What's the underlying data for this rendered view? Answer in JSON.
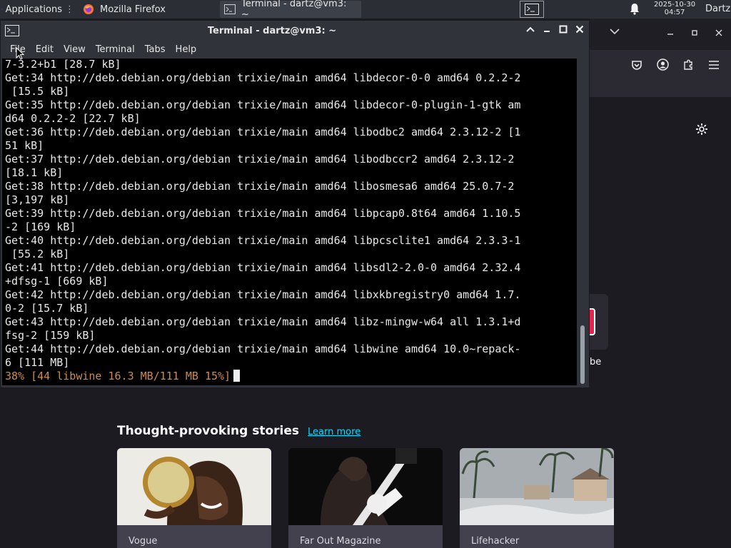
{
  "taskbar": {
    "apps_label": "Applications",
    "tasks": [
      {
        "label": "Mozilla Firefox",
        "icon": "firefox-icon"
      },
      {
        "label": "Terminal - dartz@vm3: ~",
        "icon": "terminal-icon"
      }
    ],
    "clock_date": "2025-10-30",
    "clock_time": "04:57",
    "user": "Dartz"
  },
  "terminal": {
    "title": "Terminal - dartz@vm3: ~",
    "menu": [
      "File",
      "Edit",
      "View",
      "Terminal",
      "Tabs",
      "Help"
    ],
    "lines": [
      "7-3.2+b1 [28.7 kB]",
      "Get:34 http://deb.debian.org/debian trixie/main amd64 libdecor-0-0 amd64 0.2.2-2",
      " [15.5 kB]",
      "Get:35 http://deb.debian.org/debian trixie/main amd64 libdecor-0-plugin-1-gtk am",
      "d64 0.2.2-2 [22.7 kB]",
      "Get:36 http://deb.debian.org/debian trixie/main amd64 libodbc2 amd64 2.3.12-2 [1",
      "51 kB]",
      "Get:37 http://deb.debian.org/debian trixie/main amd64 libodbccr2 amd64 2.3.12-2",
      "[18.1 kB]",
      "Get:38 http://deb.debian.org/debian trixie/main amd64 libosmesa6 amd64 25.0.7-2",
      "[3,197 kB]",
      "Get:39 http://deb.debian.org/debian trixie/main amd64 libpcap0.8t64 amd64 1.10.5",
      "-2 [169 kB]",
      "Get:40 http://deb.debian.org/debian trixie/main amd64 libpcsclite1 amd64 2.3.3-1",
      " [55.2 kB]",
      "Get:41 http://deb.debian.org/debian trixie/main amd64 libsdl2-2.0-0 amd64 2.32.4",
      "+dfsg-1 [669 kB]",
      "Get:42 http://deb.debian.org/debian trixie/main amd64 libxkbregistry0 amd64 1.7.",
      "0-2 [15.7 kB]",
      "Get:43 http://deb.debian.org/debian trixie/main amd64 libz-mingw-w64 all 1.3.1+d",
      "fsg-2 [159 kB]",
      "Get:44 http://deb.debian.org/debian trixie/main amd64 libwine amd64 10.0~repack-",
      "6 [111 MB]"
    ],
    "progress_line": "38% [44 libwine 16.3 MB/111 MB 15%]"
  },
  "firefox": {
    "tile_label": "be",
    "stories_title": "Thought-provoking stories",
    "learn_more": "Learn more",
    "cards": [
      {
        "source": "Vogue"
      },
      {
        "source": "Far Out Magazine"
      },
      {
        "source": "Lifehacker"
      }
    ]
  },
  "colors": {
    "terminal_bg": "#000000",
    "progress_text": "#d08a4a",
    "link": "#00ddff"
  }
}
